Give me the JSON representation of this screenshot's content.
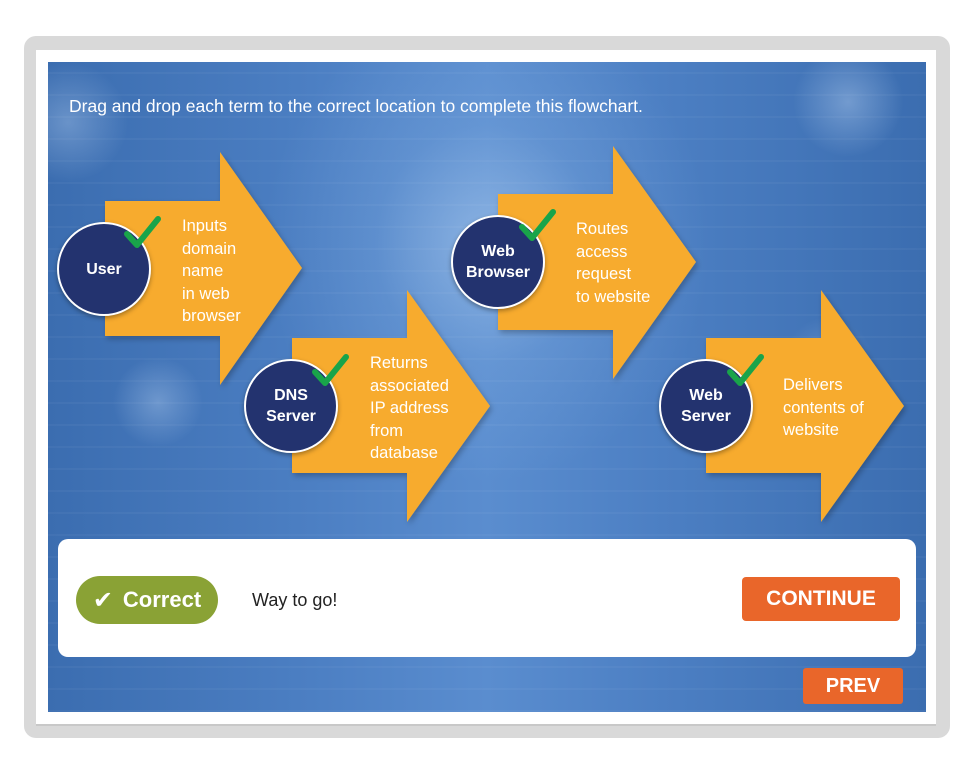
{
  "instruction": "Drag and drop each term to the correct location to complete this flowchart.",
  "colors": {
    "arrow": "#f7ab2e",
    "circle": "#23336f",
    "check": "#19a44a",
    "correct_badge": "#8aa235",
    "button": "#e9662a"
  },
  "steps": [
    {
      "term_lines": [
        "User"
      ],
      "description_lines": [
        "Inputs",
        "domain",
        "name",
        "in web",
        "browser"
      ],
      "correct": true
    },
    {
      "term_lines": [
        "DNS",
        "Server"
      ],
      "description_lines": [
        "Returns",
        "associated",
        "IP address",
        "from",
        "database"
      ],
      "correct": true
    },
    {
      "term_lines": [
        "Web",
        "Browser"
      ],
      "description_lines": [
        "Routes",
        "access",
        "request",
        "to website"
      ],
      "correct": true
    },
    {
      "term_lines": [
        "Web",
        "Server"
      ],
      "description_lines": [
        "Delivers",
        "contents of",
        "website"
      ],
      "correct": true
    }
  ],
  "feedback": {
    "badge_icon": "check-mark-icon",
    "badge_label": "Correct",
    "message": "Way to go!",
    "continue_label": "CONTINUE"
  },
  "prev_label": "PREV"
}
